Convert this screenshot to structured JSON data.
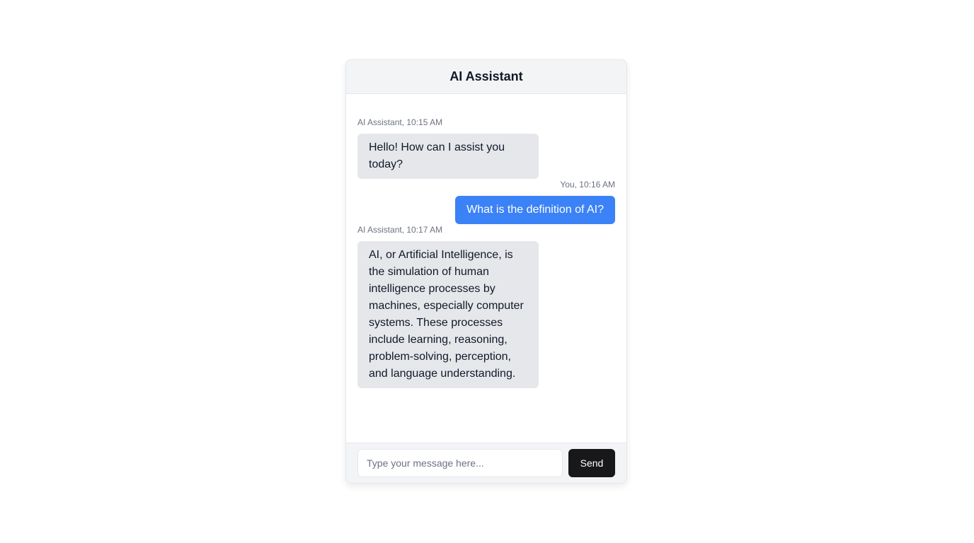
{
  "header": {
    "title": "AI Assistant"
  },
  "messages": [
    {
      "sender": "bot",
      "meta": "AI Assistant, 10:15 AM",
      "text": "Hello! How can I assist you today?"
    },
    {
      "sender": "user",
      "meta": "You, 10:16 AM",
      "text": "What is the definition of AI?"
    },
    {
      "sender": "bot",
      "meta": "AI Assistant, 10:17 AM",
      "text": "AI, or Artificial Intelligence, is the simulation of human intelligence processes by machines, especially computer systems. These processes include learning, reasoning, problem-solving, perception, and language understanding."
    }
  ],
  "composer": {
    "placeholder": "Type your message here...",
    "value": "",
    "send_label": "Send"
  },
  "colors": {
    "user_bubble": "#3b82f6",
    "bot_bubble": "#e5e7eb",
    "send_button": "#18181b",
    "header_bg": "#f3f4f6"
  }
}
